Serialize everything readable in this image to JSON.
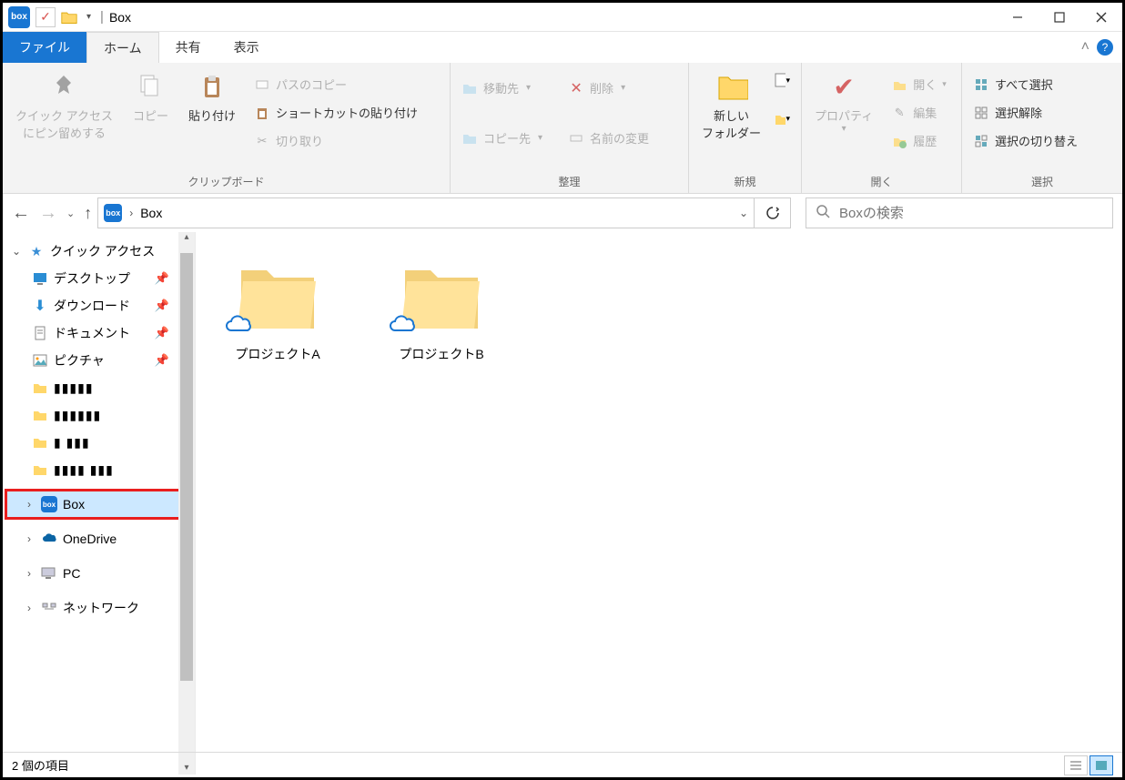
{
  "window": {
    "title": "Box"
  },
  "tabs": {
    "file": "ファイル",
    "home": "ホーム",
    "share": "共有",
    "view": "表示"
  },
  "ribbon": {
    "clipboard": {
      "label": "クリップボード",
      "pin": "クイック アクセス\nにピン留めする",
      "copy": "コピー",
      "paste": "貼り付け",
      "copy_path": "パスのコピー",
      "paste_shortcut": "ショートカットの貼り付け",
      "cut": "切り取り"
    },
    "organize": {
      "label": "整理",
      "move_to": "移動先",
      "copy_to": "コピー先",
      "delete": "削除",
      "rename": "名前の変更"
    },
    "new": {
      "label": "新規",
      "new_folder": "新しい\nフォルダー"
    },
    "open": {
      "label": "開く",
      "properties": "プロパティ",
      "open_btn": "開く",
      "edit": "編集",
      "history": "履歴"
    },
    "select": {
      "label": "選択",
      "select_all": "すべて選択",
      "select_none": "選択解除",
      "invert": "選択の切り替え"
    }
  },
  "address": {
    "current": "Box"
  },
  "search": {
    "placeholder": "Boxの検索"
  },
  "sidebar": {
    "quick_access": "クイック アクセス",
    "items": [
      {
        "label": "デスクトップ",
        "icon": "desktop",
        "pinned": true
      },
      {
        "label": "ダウンロード",
        "icon": "download",
        "pinned": true
      },
      {
        "label": "ドキュメント",
        "icon": "document",
        "pinned": true
      },
      {
        "label": "ピクチャ",
        "icon": "pictures",
        "pinned": true
      }
    ],
    "box": "Box",
    "onedrive": "OneDrive",
    "pc": "PC",
    "network": "ネットワーク"
  },
  "folders": [
    {
      "label": "プロジェクトA"
    },
    {
      "label": "プロジェクトB"
    }
  ],
  "status": {
    "items": "2 個の項目"
  }
}
